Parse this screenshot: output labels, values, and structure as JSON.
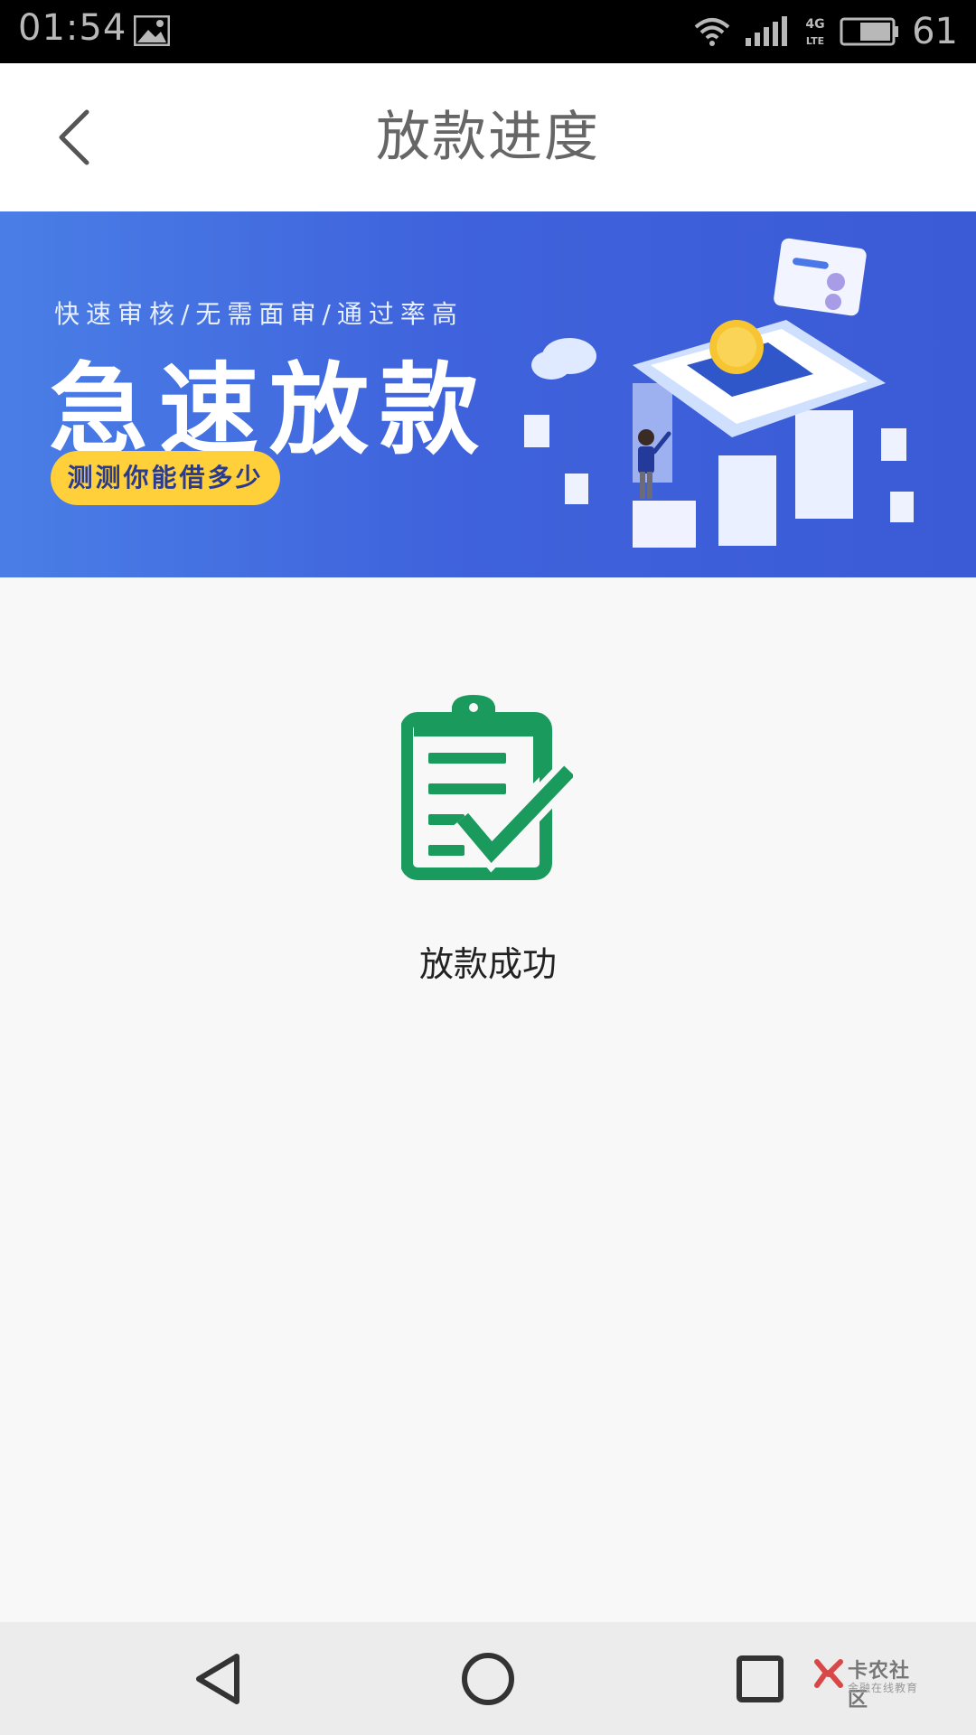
{
  "status_bar": {
    "time": "01:54",
    "network": "4G LTE",
    "battery": "61"
  },
  "header": {
    "title": "放款进度",
    "back_icon": "chevron-left-icon"
  },
  "banner": {
    "subtitle": "快速审核/无需面审/通过率高",
    "title": "急速放款",
    "cta": "测测你能借多少",
    "colors": {
      "background": "#3f63dc",
      "cta": "#ffd03a"
    }
  },
  "result": {
    "icon": "clipboard-check-icon",
    "icon_color": "#1a9a5c",
    "text": "放款成功"
  },
  "system_nav": {
    "watermark_main": "卡农社区",
    "watermark_sub": "金融在线教育"
  }
}
